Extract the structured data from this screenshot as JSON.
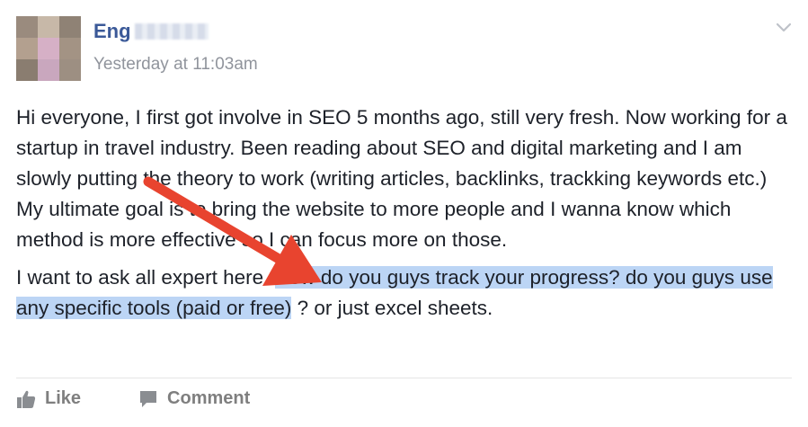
{
  "post": {
    "author_visible": "Eng",
    "timestamp": "Yesterday at 11:03am",
    "paragraph1": "Hi everyone, I first got involve in SEO 5 months ago, still very fresh. Now working for a startup in travel industry. Been reading about SEO and digital marketing and I am slowly putting the theory to work (writing articles, backlinks, trackking keywords etc.) My ultimate goal is to bring the website to more people and I wanna know which method is more effective so I can focus more on those.",
    "paragraph2_plain": "I want to ask all expert here. ",
    "paragraph2_highlighted": "How do you guys track your progress? do you guys use any specific tools (paid or free)",
    "paragraph2_rest": " ? or just excel sheets."
  },
  "actions": {
    "like_label": "Like",
    "comment_label": "Comment"
  },
  "icons": {
    "menu": "chevron-down-icon",
    "like": "thumbs-up-icon",
    "comment": "speech-bubble-icon",
    "annotation": "red-arrow"
  },
  "colors": {
    "author": "#3b5998",
    "timestamp": "#90949c",
    "text": "#1d2129",
    "highlight": "#bcd5f5",
    "arrow": "#e8442f",
    "action": "#7f7f7f"
  }
}
